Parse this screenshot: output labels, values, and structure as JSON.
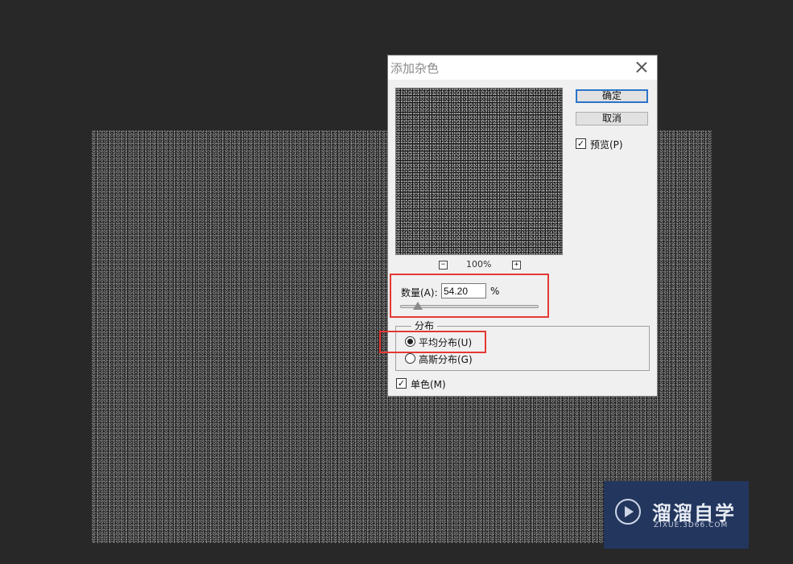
{
  "dialog": {
    "title": "添加杂色",
    "ok_label": "确定",
    "cancel_label": "取消",
    "preview_label": "预览(P)",
    "preview_checked": true,
    "zoom_level": "100%",
    "zoom_out_symbol": "−",
    "zoom_in_symbol": "+",
    "amount": {
      "label": "数量(A):",
      "value": "54.20",
      "unit": "%",
      "slider_fraction": 0.13
    },
    "distribution": {
      "group_label": "分布",
      "options": [
        {
          "label": "平均分布(U)",
          "selected": true
        },
        {
          "label": "高斯分布(G)",
          "selected": false
        }
      ]
    },
    "monochromatic": {
      "label": "单色(M)",
      "checked": true
    }
  },
  "watermark": {
    "name": "溜溜自学",
    "url": "ZIXUE.3D66.COM"
  },
  "colors": {
    "workspace_bg": "#282828",
    "dialog_bg": "#f0f0f0",
    "highlight": "#e53935",
    "primary_button_border": "#2a74c9",
    "watermark_bg": "#23365e"
  },
  "icons": [
    "close-icon",
    "zoom-out-icon",
    "zoom-in-icon",
    "checkmark-icon",
    "play-logo-icon"
  ]
}
